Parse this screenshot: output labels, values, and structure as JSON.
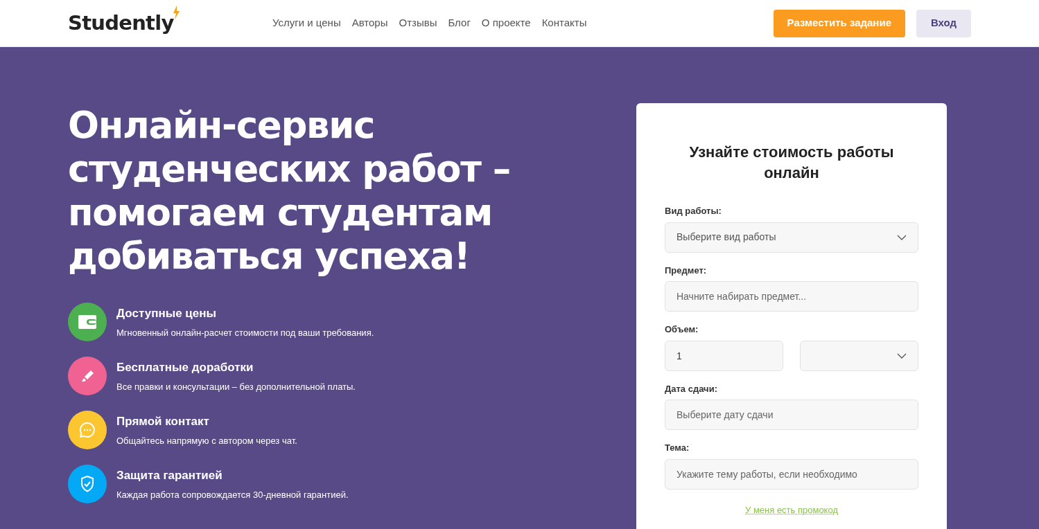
{
  "header": {
    "logo": "Studently",
    "nav": [
      "Услуги и цены",
      "Авторы",
      "Отзывы",
      "Блог",
      "О проекте",
      "Контакты"
    ],
    "primary_button": "Разместить задание",
    "login_button": "Вход"
  },
  "hero": {
    "title": "Онлайн-сервис студенческих работ – помогаем студентам добиваться успеха!",
    "features": [
      {
        "kind": "wallet",
        "color": "#4caf50",
        "title": "Доступные цены",
        "text": "Мгновенный онлайн-расчет стоимости под ваши требования."
      },
      {
        "kind": "pen",
        "color": "#f06292",
        "title": "Бесплатные доработки",
        "text": "Все правки и консультации – без дополнительной платы."
      },
      {
        "kind": "chat",
        "color": "#fcc630",
        "title": "Прямой контакт",
        "text": "Общайтесь напрямую с автором через чат."
      },
      {
        "kind": "shield",
        "color": "#03a9f4",
        "title": "Защита гарантией",
        "text": "Каждая работа сопровождается 30-дневной гарантией."
      }
    ]
  },
  "form": {
    "title": "Узнайте стоимость работы онлайн",
    "fields": [
      {
        "kind": "select",
        "label": "Вид работы:",
        "placeholder": "Выберите вид работы"
      },
      {
        "kind": "input",
        "label": "Предмет:",
        "placeholder": "Начните набирать предмет..."
      },
      {
        "kind": "volume",
        "label": "Объем:",
        "value": "1"
      },
      {
        "kind": "input",
        "label": "Дата сдачи:",
        "placeholder": "Выберите дату сдачи"
      },
      {
        "kind": "input",
        "label": "Тема:",
        "placeholder": "Укажите тему работы, если необходимо"
      }
    ],
    "promo_link": "У меня есть промокод"
  }
}
